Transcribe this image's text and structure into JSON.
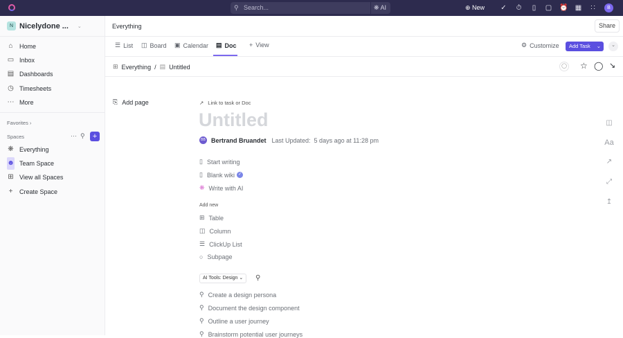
{
  "topbar": {
    "search_placeholder": "Search...",
    "ai_label": "AI",
    "new_label": "New",
    "avatar_initial": "B"
  },
  "sidebar": {
    "workspace_initial": "N",
    "workspace_name": "Nicelydone ...",
    "nav": [
      "Home",
      "Inbox",
      "Dashboards",
      "Timesheets",
      "More"
    ],
    "favorites_label": "Favorites",
    "spaces_label": "Spaces",
    "spaces": [
      "Everything",
      "Team Space",
      "View all Spaces",
      "Create Space"
    ]
  },
  "header": {
    "title": "Everything",
    "share_label": "Share"
  },
  "tabs": {
    "items": [
      "List",
      "Board",
      "Calendar",
      "Doc"
    ],
    "view_label": "View",
    "customize_label": "Customize",
    "add_task_label": "Add Task"
  },
  "breadcrumb": {
    "parent": "Everything",
    "separator": "/",
    "current": "Untitled"
  },
  "doc": {
    "add_page": "Add page",
    "link_label": "Link to task or Doc",
    "title_placeholder": "Untitled",
    "author_initials": "BB",
    "author": "Bertrand Bruandet",
    "last_updated": "Last Updated:  5 days ago at 11:28 pm",
    "start_options": [
      "Start writing",
      "Blank wiki",
      "Write with AI"
    ],
    "add_new_label": "Add new",
    "add_new": [
      "Table",
      "Column",
      "ClickUp List",
      "Subpage"
    ],
    "ai_tools_label": "AI Tools: Design",
    "ai_suggestions": [
      "Create a design persona",
      "Document the design component",
      "Outline a user journey",
      "Brainstorm potential user journeys"
    ]
  },
  "rail": {
    "font_label": "Aa"
  },
  "colors": {
    "accent": "#5b4fe0",
    "topbar": "#2d2b4e"
  }
}
